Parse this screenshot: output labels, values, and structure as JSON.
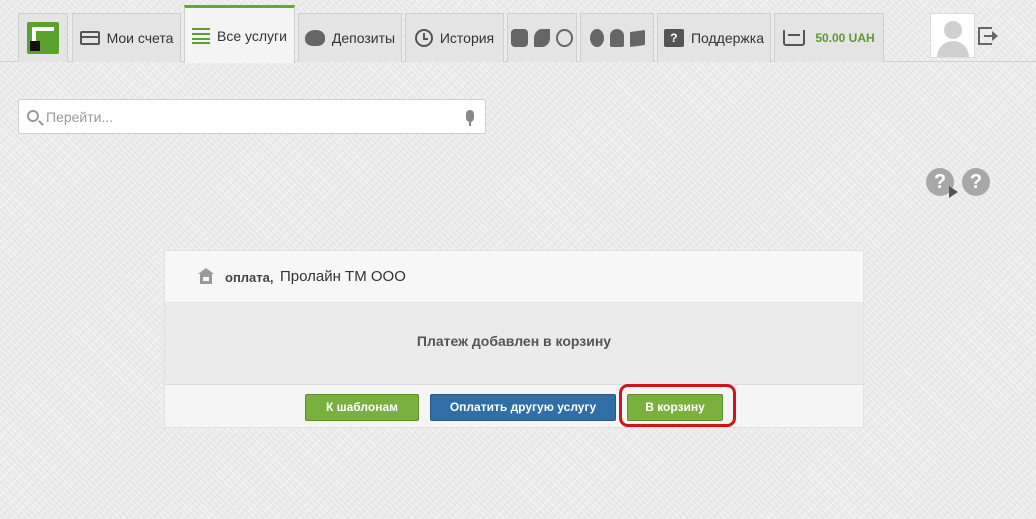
{
  "nav": {
    "tabs": [
      {
        "id": "logo",
        "icon": "privatbank-logo-icon"
      },
      {
        "id": "accounts",
        "label": "Мои счета",
        "icon": "card-icon"
      },
      {
        "id": "services",
        "label": "Все услуги",
        "icon": "list-icon",
        "active": true
      },
      {
        "id": "deposits",
        "label": "Депозиты",
        "icon": "piggy-bank-icon"
      },
      {
        "id": "history",
        "label": "История",
        "icon": "history-icon"
      },
      {
        "id": "travel",
        "icons": [
          "train-icon",
          "plane-icon",
          "globe-icon"
        ]
      },
      {
        "id": "apps",
        "icons": [
          "apple-icon",
          "android-icon",
          "windows-icon"
        ]
      },
      {
        "id": "support",
        "label": "Поддержка",
        "icon": "support-icon"
      },
      {
        "id": "cart",
        "balance": "50.00 UAH",
        "icon": "cart-icon"
      }
    ]
  },
  "search": {
    "placeholder": "Перейти..."
  },
  "help": {
    "video": "?",
    "info": "?"
  },
  "card": {
    "payment_kind": "оплата,",
    "provider": "Пролайн ТМ ООО",
    "message": "Платеж добавлен в корзину",
    "buttons": {
      "templates": "К шаблонам",
      "pay_other": "Оплатить другую услугу",
      "to_cart": "В корзину"
    }
  },
  "colors": {
    "accent_green": "#79b03e",
    "primary_blue": "#2f6fa6",
    "highlight_red": "#d0151b"
  }
}
